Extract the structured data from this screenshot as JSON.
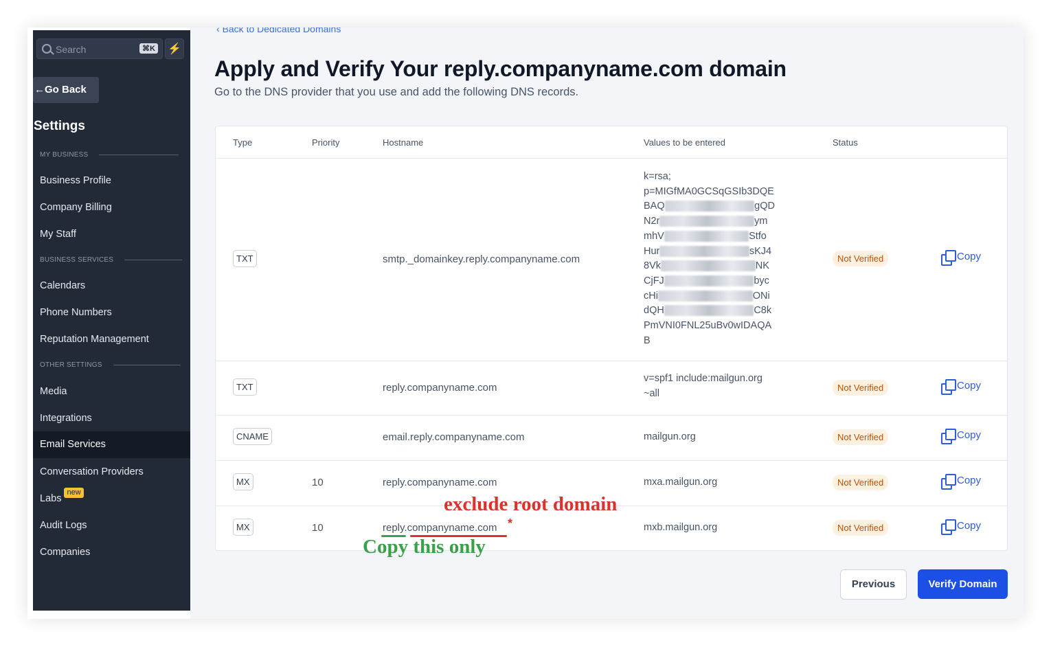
{
  "sidebar": {
    "search_placeholder": "Search",
    "search_shortcut": "⌘K",
    "quick_action_icon": "⚡",
    "go_back": "Go Back",
    "title": "Settings",
    "sections": {
      "my_business": "MY BUSINESS",
      "business_services": "BUSINESS SERVICES",
      "other_settings": "OTHER SETTINGS"
    },
    "items": {
      "business_profile": "Business Profile",
      "company_billing": "Company Billing",
      "my_staff": "My Staff",
      "calendars": "Calendars",
      "phone_numbers": "Phone Numbers",
      "reputation_management": "Reputation Management",
      "media": "Media",
      "integrations": "Integrations",
      "email_services": "Email Services",
      "conversation_providers": "Conversation Providers",
      "labs": "Labs",
      "labs_badge": "new",
      "audit_logs": "Audit Logs",
      "companies": "Companies"
    }
  },
  "main": {
    "back_link": "Back to Dedicated Domains",
    "title": "Apply and Verify Your reply.companyname.com domain",
    "subtitle": "Go to the DNS provider that you use and add the following DNS records.",
    "columns": [
      "Type",
      "Priority",
      "Hostname",
      "Values to be entered",
      "Status"
    ],
    "rows": [
      {
        "type": "TXT",
        "priority": "",
        "hostname": "smtp._domainkey.reply.companyname.com",
        "value_lines": [
          "k=rsa;",
          "p=MIGfMA0GCSqGSIb3DQE",
          "BAQ",
          "gQD",
          "N2r",
          "ym",
          "mhV",
          "Stfo",
          "Hur",
          "sKJ4",
          "8Vk",
          "NK",
          "CjFJ",
          "byc",
          "cHi",
          "ONi",
          "dQH",
          "C8k",
          "PmVNI0FNL25uBv0wIDAQA",
          "B"
        ],
        "status": "Not Verified",
        "copy": "Copy"
      },
      {
        "type": "TXT",
        "priority": "",
        "hostname": "reply.companyname.com",
        "value": "v=spf1 include:mailgun.org",
        "value2": "~all",
        "status": "Not Verified",
        "copy": "Copy"
      },
      {
        "type": "CNAME",
        "priority": "",
        "hostname": "email.reply.companyname.com",
        "value": "mailgun.org",
        "status": "Not Verified",
        "copy": "Copy"
      },
      {
        "type": "MX",
        "priority": "10",
        "hostname": "reply.companyname.com",
        "value": "mxa.mailgun.org",
        "status": "Not Verified",
        "copy": "Copy"
      },
      {
        "type": "MX",
        "priority": "10",
        "hostname": "reply.companyname.com",
        "value": "mxb.mailgun.org",
        "status": "Not Verified",
        "copy": "Copy"
      }
    ],
    "buttons": {
      "previous": "Previous",
      "verify": "Verify Domain"
    }
  },
  "annotations": {
    "exclude": "exclude root domain",
    "copy_only": "Copy this only",
    "marker": "*"
  }
}
